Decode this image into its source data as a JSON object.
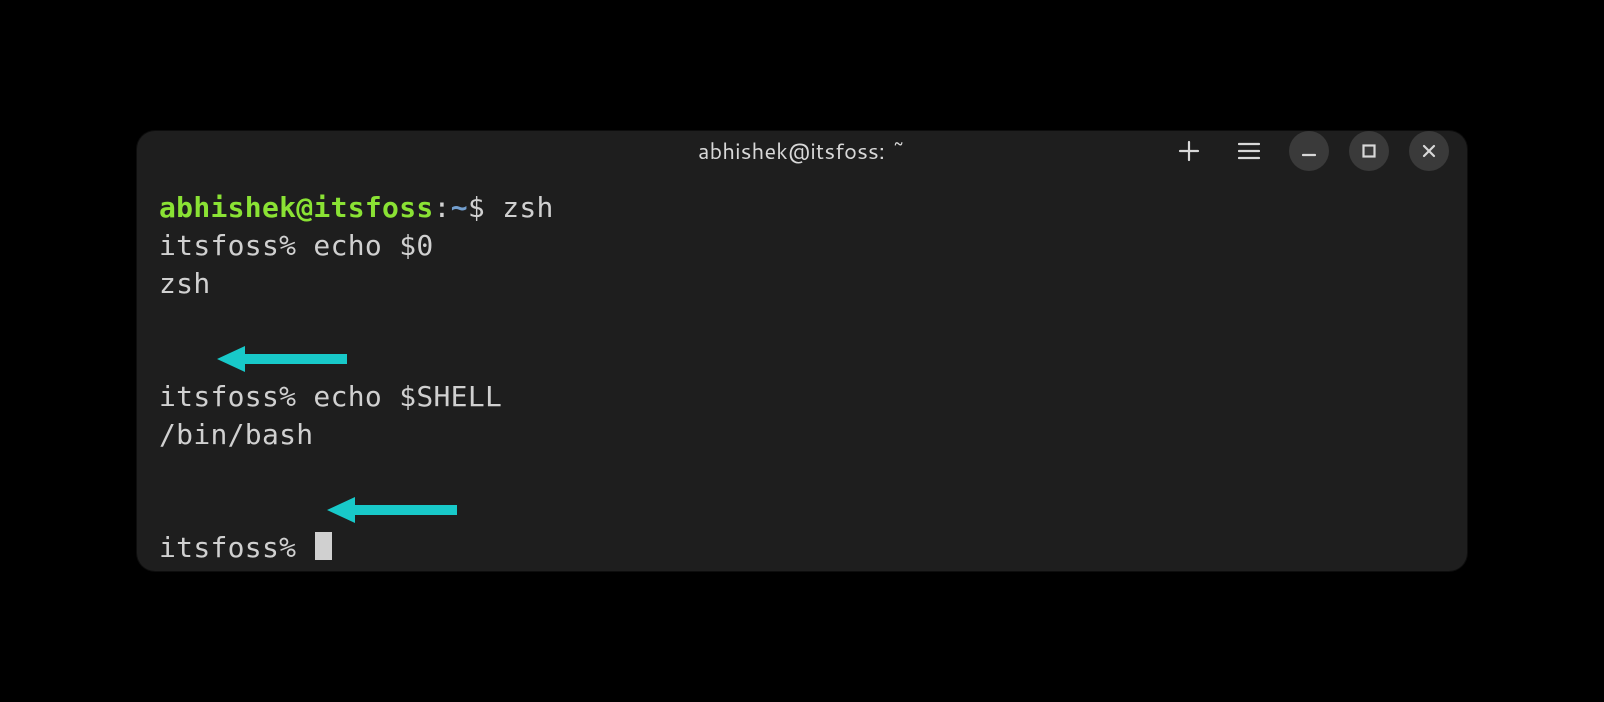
{
  "window": {
    "title": "abhishek@itsfoss: ~"
  },
  "icons": {
    "new_tab": "plus",
    "menu": "hamburger",
    "minimize": "minimize",
    "maximize": "maximize",
    "close": "close"
  },
  "colors": {
    "prompt_user": "#8ae234",
    "prompt_path": "#739fcf",
    "arrow": "#18c9c9",
    "bg": "#1e1e1e"
  },
  "terminal": {
    "bash_prompt": {
      "user_host": "abhishek@itsfoss",
      "sep1": ":",
      "path": "~",
      "sep2": "$ ",
      "cmd": "zsh"
    },
    "lines": [
      {
        "prompt": "itsfoss% ",
        "cmd": "echo $0"
      },
      {
        "output": "zsh"
      },
      {
        "prompt": "itsfoss% ",
        "cmd": "echo $SHELL"
      },
      {
        "output": "/bin/bash"
      },
      {
        "prompt": "itsfoss% ",
        "cursor": true
      }
    ]
  }
}
